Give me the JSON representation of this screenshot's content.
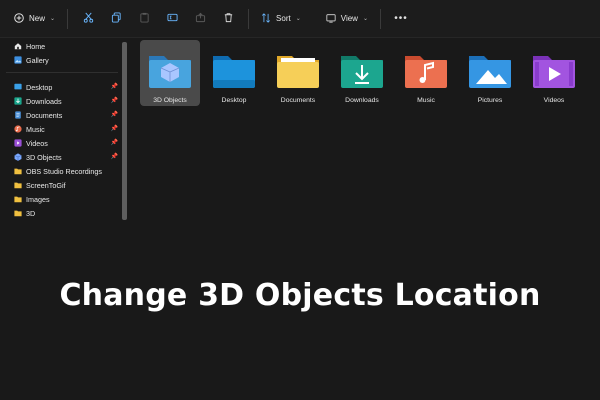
{
  "toolbar": {
    "new_label": "New",
    "sort_label": "Sort",
    "view_label": "View",
    "icons": [
      "plus-circle-icon",
      "cut-icon",
      "copy-icon",
      "paste-icon",
      "rename-icon",
      "share-icon",
      "delete-icon",
      "sort-icon",
      "view-icon",
      "more-icon"
    ]
  },
  "sidebar": {
    "top_items": [
      {
        "label": "Home",
        "icon": "home-icon"
      },
      {
        "label": "Gallery",
        "icon": "gallery-icon"
      }
    ],
    "pinned_items": [
      {
        "label": "Desktop",
        "icon": "desktop-icon",
        "pinned": true
      },
      {
        "label": "Downloads",
        "icon": "downloads-icon",
        "pinned": true
      },
      {
        "label": "Documents",
        "icon": "documents-icon",
        "pinned": true
      },
      {
        "label": "Music",
        "icon": "music-icon",
        "pinned": true
      },
      {
        "label": "Videos",
        "icon": "videos-icon",
        "pinned": true
      },
      {
        "label": "3D Objects",
        "icon": "3d-objects-icon",
        "pinned": true
      }
    ],
    "folders": [
      {
        "label": "OBS Studio Recordings",
        "icon": "folder-icon"
      },
      {
        "label": "ScreenToGif",
        "icon": "folder-icon"
      },
      {
        "label": "Images",
        "icon": "folder-icon"
      },
      {
        "label": "3D",
        "icon": "folder-icon"
      }
    ]
  },
  "content": {
    "folders": [
      {
        "label": "3D Objects",
        "icon": "3d-objects-folder-icon",
        "selected": true,
        "color": "#3e9ad6"
      },
      {
        "label": "Desktop",
        "icon": "desktop-folder-icon",
        "selected": false,
        "color": "#1d8fd8"
      },
      {
        "label": "Documents",
        "icon": "documents-folder-icon",
        "selected": false,
        "color": "#f2c94c"
      },
      {
        "label": "Downloads",
        "icon": "downloads-folder-icon",
        "selected": false,
        "color": "#1a9e8a"
      },
      {
        "label": "Music",
        "icon": "music-folder-icon",
        "selected": false,
        "color": "#e86a4a"
      },
      {
        "label": "Pictures",
        "icon": "pictures-folder-icon",
        "selected": false,
        "color": "#2e8fde"
      },
      {
        "label": "Videos",
        "icon": "videos-folder-icon",
        "selected": false,
        "color": "#9a4fd6"
      }
    ]
  },
  "headline": "Change 3D Objects Location"
}
